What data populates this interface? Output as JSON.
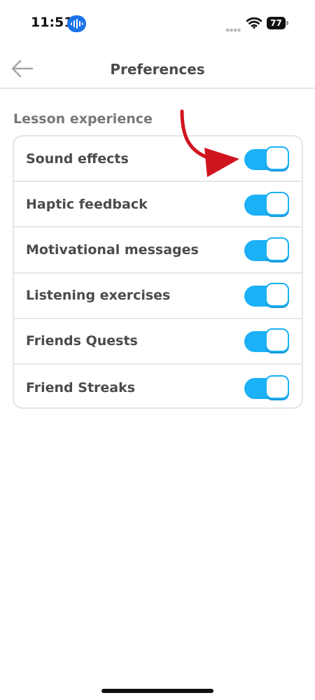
{
  "status_bar": {
    "time": "11:51",
    "battery": "77",
    "icons": [
      "recording-badge-icon",
      "cellular-signal-icon",
      "wifi-icon",
      "battery-icon"
    ]
  },
  "header": {
    "title": "Preferences",
    "back_icon": "arrow-left-icon"
  },
  "section": {
    "title": "Lesson experience",
    "items": [
      {
        "label": "Sound effects",
        "enabled": true
      },
      {
        "label": "Haptic feedback",
        "enabled": true
      },
      {
        "label": "Motivational messages",
        "enabled": true
      },
      {
        "label": "Listening exercises",
        "enabled": true
      },
      {
        "label": "Friends Quests",
        "enabled": true
      },
      {
        "label": "Friend Streaks",
        "enabled": true
      }
    ]
  },
  "colors": {
    "toggle_on": "#1cb0f6",
    "annotation_arrow": "#d0141f",
    "text": "#4b4b4b",
    "section_title": "#777777"
  }
}
